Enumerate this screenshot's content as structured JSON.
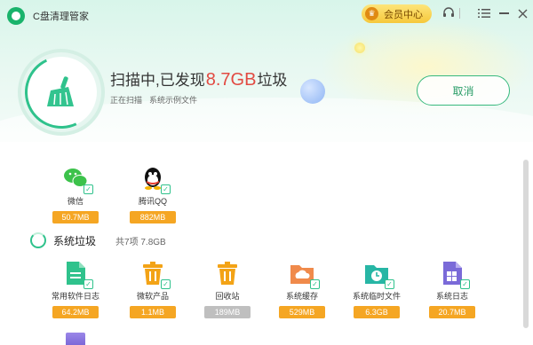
{
  "window": {
    "title": "C盘清理管家",
    "vip_label": "会员中心"
  },
  "scan": {
    "prefix": "扫描中,已发现",
    "size": "8.7GB",
    "suffix": "垃圾",
    "status": "正在扫描",
    "detail": "系统示例文件",
    "cancel_label": "取消"
  },
  "apps": [
    {
      "name": "微信",
      "size": "50.7MB",
      "icon": "wechat-icon",
      "color": "#3cc24b"
    },
    {
      "name": "腾讯QQ",
      "size": "882MB",
      "icon": "qq-icon",
      "color": "#111111"
    }
  ],
  "system_section": {
    "title": "系统垃圾",
    "count": "共7项 7.8GB"
  },
  "system_items": [
    {
      "name": "常用软件日志",
      "size": "64.2MB",
      "icon": "document-icon",
      "color": "#2fc28c",
      "badge": "orange"
    },
    {
      "name": "微软产品",
      "size": "1.1MB",
      "icon": "trash-icon",
      "color": "#f3a316",
      "badge": "orange"
    },
    {
      "name": "回收站",
      "size": "189MB",
      "icon": "recycle-bin-icon",
      "color": "#f3a316",
      "badge": "gray"
    },
    {
      "name": "系统缓存",
      "size": "529MB",
      "icon": "cloud-folder-icon",
      "color": "#f08a4b",
      "badge": "orange"
    },
    {
      "name": "系统临时文件",
      "size": "6.3GB",
      "icon": "clock-folder-icon",
      "color": "#27b6a5",
      "badge": "orange"
    },
    {
      "name": "系统日志",
      "size": "20.7MB",
      "icon": "windows-log-icon",
      "color": "#7a6ad8",
      "badge": "orange"
    }
  ]
}
